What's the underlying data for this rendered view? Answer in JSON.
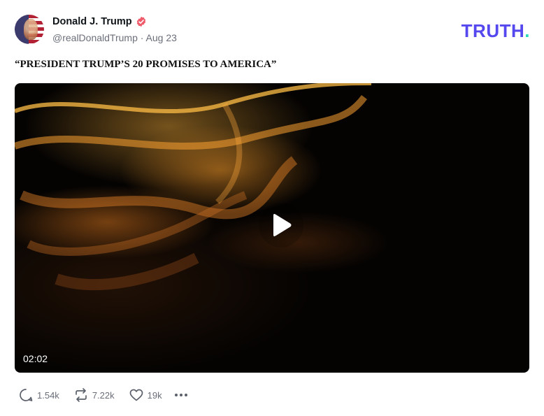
{
  "post": {
    "author_name": "Donald J. Trump",
    "handle_and_date": "@realDonaldTrump · Aug 23",
    "text": "“PRESIDENT TRUMP’S 20 PROMISES TO AMERICA”"
  },
  "brand": {
    "logo_text": "TRUTH",
    "logo_dot": ".",
    "logo_color": "#5448ee",
    "dot_color": "#2bd9b8"
  },
  "video": {
    "duration": "02:02",
    "play_icon": "play-icon"
  },
  "actions": {
    "replies": "1.54k",
    "retruths": "7.22k",
    "likes": "19k",
    "reply_icon": "comment-icon",
    "retruth_icon": "repost-icon",
    "like_icon": "heart-icon",
    "more_icon": "more-horizontal-icon"
  },
  "colors": {
    "verified": "#ef5c6c",
    "muted_text": "#6b6f7a"
  }
}
